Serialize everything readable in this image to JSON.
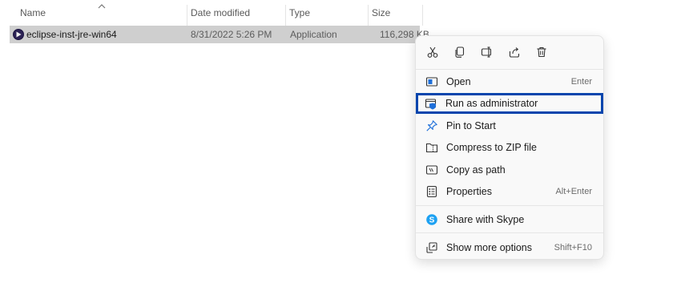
{
  "columns": {
    "name": "Name",
    "date_modified": "Date modified",
    "type": "Type",
    "size": "Size"
  },
  "file": {
    "name": "eclipse-inst-jre-win64",
    "date_modified": "8/31/2022 5:26 PM",
    "type": "Application",
    "size": "116,298 KB"
  },
  "quick_actions": [
    {
      "icon": "cut-icon"
    },
    {
      "icon": "copy-icon"
    },
    {
      "icon": "rename-icon"
    },
    {
      "icon": "share-icon"
    },
    {
      "icon": "delete-icon"
    }
  ],
  "menu": {
    "open": {
      "label": "Open",
      "shortcut": "Enter",
      "icon": "open-window-icon"
    },
    "run_admin": {
      "label": "Run as administrator",
      "icon": "shield-admin-icon"
    },
    "pin_start": {
      "label": "Pin to Start",
      "icon": "pin-icon"
    },
    "compress_zip": {
      "label": "Compress to ZIP file",
      "icon": "zip-folder-icon"
    },
    "copy_path": {
      "label": "Copy as path",
      "icon": "copy-path-icon"
    },
    "properties": {
      "label": "Properties",
      "shortcut": "Alt+Enter",
      "icon": "properties-icon"
    },
    "share_skype": {
      "label": "Share with Skype",
      "icon": "skype-icon"
    },
    "show_more": {
      "label": "Show more options",
      "shortcut": "Shift+F10",
      "icon": "show-more-icon"
    }
  },
  "colors": {
    "highlight_border": "#0645ad",
    "selected_row": "#cfcfcf",
    "skype_blue": "#1da1f2",
    "accent_blue": "#1e6fd9"
  }
}
